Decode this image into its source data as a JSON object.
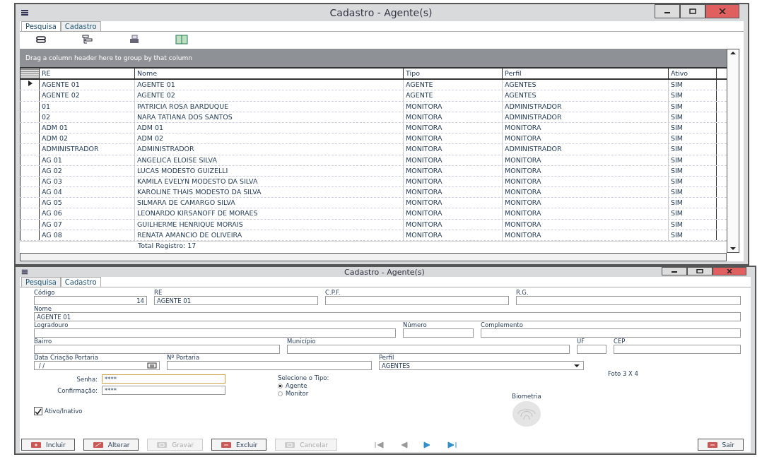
{
  "search_window": {
    "title": "Cadastro - Agente(s)",
    "tabs": [
      {
        "label": "Pesquisa",
        "selected": true
      },
      {
        "label": "Cadastro",
        "selected": false
      }
    ],
    "toolbar": [
      {
        "kind": "stack"
      },
      {
        "kind": "tree"
      },
      {
        "kind": "print"
      },
      {
        "kind": "card"
      }
    ],
    "group_panel_hint": "Drag a column header here to group by that column",
    "table": {
      "columns": [
        "RE",
        "Nome",
        "Tipo",
        "Perfil",
        "Ativo"
      ],
      "rows": [
        {
          "selected": true,
          "cells": [
            "AGENTE 01",
            "AGENTE 01",
            "AGENTE",
            "AGENTES",
            "SIM"
          ]
        },
        {
          "selected": false,
          "cells": [
            "AGENTE 02",
            "AGENTE 02",
            "AGENTE",
            "AGENTES",
            "SIM"
          ]
        },
        {
          "selected": false,
          "cells": [
            "01",
            "PATRICIA ROSA BARDUQUE",
            "MONITORA",
            "ADMINISTRADOR",
            "SIM"
          ]
        },
        {
          "selected": false,
          "cells": [
            "02",
            "NARA TATIANA DOS SANTOS",
            "MONITORA",
            "ADMINISTRADOR",
            "SIM"
          ]
        },
        {
          "selected": false,
          "cells": [
            "ADM 01",
            "ADM 01",
            "MONITORA",
            "MONITORA",
            "SIM"
          ]
        },
        {
          "selected": false,
          "cells": [
            "ADM 02",
            "ADM 02",
            "MONITORA",
            "MONITORA",
            "SIM"
          ]
        },
        {
          "selected": false,
          "cells": [
            "ADMINISTRADOR",
            "ADMINISTRADOR",
            "MONITORA",
            "ADMINISTRADOR",
            "SIM"
          ]
        },
        {
          "selected": false,
          "cells": [
            "AG 01",
            "ANGELICA ELOISE SILVA",
            "MONITORA",
            "MONITORA",
            "SIM"
          ]
        },
        {
          "selected": false,
          "cells": [
            "AG 02",
            "LUCAS MODESTO GUIZELLI",
            "MONITORA",
            "MONITORA",
            "SIM"
          ]
        },
        {
          "selected": false,
          "cells": [
            "AG 03",
            "KAMILA EVELYN MODESTO DA SILVA",
            "MONITORA",
            "MONITORA",
            "SIM"
          ]
        },
        {
          "selected": false,
          "cells": [
            "AG 04",
            "KAROLINE THAIS MODESTO DA SILVA",
            "MONITORA",
            "MONITORA",
            "SIM"
          ]
        },
        {
          "selected": false,
          "cells": [
            "AG 05",
            "SILMARA DE CAMARGO SILVA",
            "MONITORA",
            "MONITORA",
            "SIM"
          ]
        },
        {
          "selected": false,
          "cells": [
            "AG 06",
            "LEONARDO KIRSANOFF DE MORAES",
            "MONITORA",
            "MONITORA",
            "SIM"
          ]
        },
        {
          "selected": false,
          "cells": [
            "AG 07",
            "GUILHERME HENRIQUE MORAIS",
            "MONITORA",
            "MONITORA",
            "SIM"
          ]
        },
        {
          "selected": false,
          "cells": [
            "AG 08",
            "RENATA AMANCIO DE OLIVEIRA",
            "MONITORA",
            "MONITORA",
            "SIM"
          ]
        }
      ],
      "footer": "Total Registro: 17"
    }
  },
  "form_window": {
    "title": "Cadastro - Agente(s)",
    "tabs": [
      {
        "label": "Pesquisa",
        "selected": false
      },
      {
        "label": "Cadastro",
        "selected": true
      }
    ],
    "rows": [
      [
        {
          "label": "Código",
          "value": "14",
          "kind": "number"
        },
        {
          "label": "RE",
          "value": "AGENTE 01",
          "kind": "text"
        },
        {
          "label": "C.P.F.",
          "kind": "text"
        },
        {
          "label": "R.G.",
          "kind": "text"
        }
      ],
      [
        {
          "label": "Nome",
          "value": "AGENTE 01",
          "kind": "text"
        }
      ],
      [
        {
          "label": "Logradouro",
          "kind": "text"
        },
        {
          "label": "Número",
          "kind": "text"
        },
        {
          "label": "Complemento",
          "kind": "text"
        }
      ],
      [
        {
          "label": "Bairro",
          "kind": "text"
        },
        {
          "label": "Município",
          "kind": "text"
        },
        {
          "label": "UF",
          "kind": "text"
        },
        {
          "label": "CEP",
          "kind": "text"
        }
      ],
      [
        {
          "label": "Data Criação Portaria",
          "value": " / /",
          "kind": "date"
        },
        {
          "label": "Nº Portaria",
          "kind": "text"
        },
        {
          "label": "Perfil",
          "value": "AGENTES",
          "kind": "select"
        }
      ]
    ],
    "photo_caption": "Foto 3 X 4",
    "passwords": [
      {
        "label": "Senha:",
        "value": "****"
      },
      {
        "label": "Confirmação:",
        "value": "****"
      }
    ],
    "type_group": {
      "label": "Selecione o Tipo:",
      "options": [
        {
          "label": "Agente",
          "selected": true
        },
        {
          "label": "Monitor",
          "selected": false
        }
      ]
    },
    "biometrics_label": "Biometria",
    "active_checkbox": {
      "label": "Ativo/Inativo",
      "checked": true
    },
    "buttons": [
      {
        "label": "Incluir",
        "disabled": false,
        "kind": "plus"
      },
      {
        "label": "Alterar",
        "disabled": false,
        "kind": "edit"
      },
      {
        "label": "Gravar",
        "disabled": true,
        "kind": "save"
      },
      {
        "label": "Excluir",
        "disabled": false,
        "kind": "minus"
      },
      {
        "label": "Cancelar",
        "disabled": true,
        "kind": "cancel"
      }
    ],
    "navigation": [
      {
        "kind": "first",
        "disabled": true
      },
      {
        "kind": "prev",
        "disabled": true
      },
      {
        "kind": "next",
        "disabled": false
      },
      {
        "kind": "last",
        "disabled": false
      }
    ],
    "exit_button": {
      "label": "Sair"
    }
  }
}
